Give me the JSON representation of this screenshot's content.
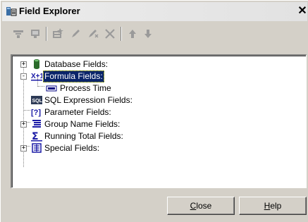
{
  "window": {
    "title": "Field Explorer",
    "close_glyph": "✕"
  },
  "toolbar": {
    "buttons": [
      {
        "icon": "insert-to-report-icon"
      },
      {
        "icon": "browse-data-icon"
      },
      {
        "icon": "new-field-icon"
      },
      {
        "icon": "edit-icon"
      },
      {
        "icon": "rename-icon"
      },
      {
        "icon": "delete-icon"
      },
      {
        "icon": "move-up-icon"
      },
      {
        "icon": "move-down-icon"
      }
    ]
  },
  "tree": {
    "items": [
      {
        "label": "Database Fields:",
        "icon": "database-icon",
        "expander": "+"
      },
      {
        "label": "Formula Fields:",
        "icon": "formula-icon",
        "expander": "-",
        "selected": true
      },
      {
        "label": "Process Time",
        "icon": "formula-field-icon",
        "child": true
      },
      {
        "label": "SQL Expression Fields:",
        "icon": "sql-icon"
      },
      {
        "label": "Parameter Fields:",
        "icon": "parameter-icon"
      },
      {
        "label": "Group Name Fields:",
        "icon": "group-name-icon",
        "expander": "+"
      },
      {
        "label": "Running Total Fields:",
        "icon": "running-total-icon"
      },
      {
        "label": "Special Fields:",
        "icon": "special-fields-icon",
        "expander": "+"
      }
    ]
  },
  "buttons": {
    "close_prefix": "",
    "close_mnemonic": "C",
    "close_rest": "lose",
    "help_prefix": "",
    "help_mnemonic": "H",
    "help_rest": "elp"
  },
  "colors": {
    "selection": "#0a246a",
    "face": "#d4d0c8"
  }
}
